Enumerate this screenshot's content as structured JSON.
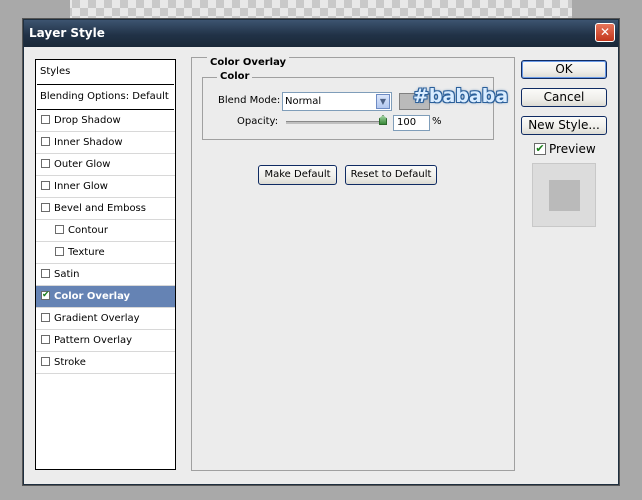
{
  "window": {
    "title": "Layer Style",
    "close_glyph": "✕"
  },
  "styles_panel": {
    "header": "Styles",
    "blending_options": "Blending Options: Default",
    "items": [
      {
        "label": "Drop Shadow",
        "checked": false,
        "indent": false
      },
      {
        "label": "Inner Shadow",
        "checked": false,
        "indent": false
      },
      {
        "label": "Outer Glow",
        "checked": false,
        "indent": false
      },
      {
        "label": "Inner Glow",
        "checked": false,
        "indent": false
      },
      {
        "label": "Bevel and Emboss",
        "checked": false,
        "indent": false
      },
      {
        "label": "Contour",
        "checked": false,
        "indent": true
      },
      {
        "label": "Texture",
        "checked": false,
        "indent": true
      },
      {
        "label": "Satin",
        "checked": false,
        "indent": false
      },
      {
        "label": "Color Overlay",
        "checked": true,
        "indent": false,
        "selected": true
      },
      {
        "label": "Gradient Overlay",
        "checked": false,
        "indent": false
      },
      {
        "label": "Pattern Overlay",
        "checked": false,
        "indent": false
      },
      {
        "label": "Stroke",
        "checked": false,
        "indent": false
      }
    ]
  },
  "color_overlay": {
    "group_title": "Color Overlay",
    "color_group_title": "Color",
    "blend_mode_label": "Blend Mode:",
    "blend_mode_value": "Normal",
    "swatch_color": "#bababa",
    "hex_annotation": "#bababa",
    "opacity_label": "Opacity:",
    "opacity_value": "100",
    "opacity_unit": "%",
    "make_default": "Make Default",
    "reset_to_default": "Reset to Default"
  },
  "buttons": {
    "ok": "OK",
    "cancel": "Cancel",
    "new_style": "New Style..."
  },
  "preview": {
    "label": "Preview",
    "checked": true,
    "swatch_color": "#bababa"
  },
  "icons": {
    "checkbox_check": "✔",
    "dropdown_arrow": "▼"
  }
}
